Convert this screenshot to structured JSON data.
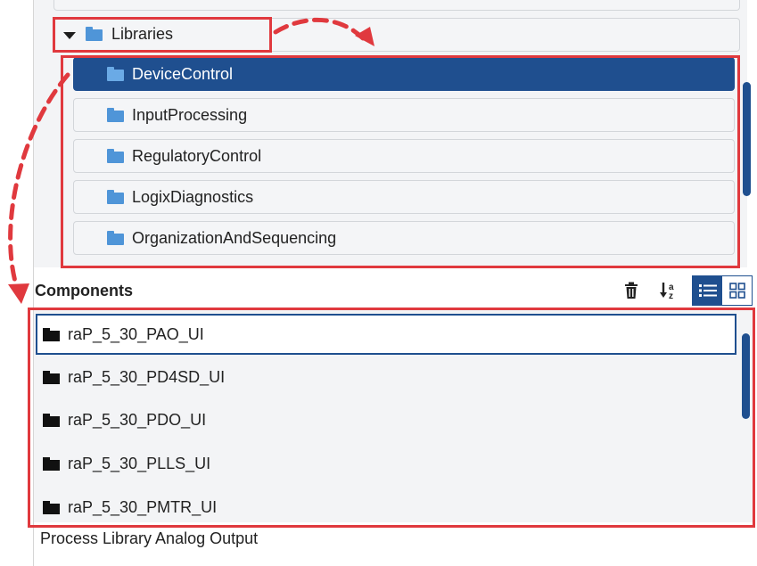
{
  "tree": {
    "libraries_label": "Libraries",
    "items": [
      {
        "label": "DeviceControl",
        "selected": true
      },
      {
        "label": "InputProcessing",
        "selected": false
      },
      {
        "label": "RegulatoryControl",
        "selected": false
      },
      {
        "label": "LogixDiagnostics",
        "selected": false
      },
      {
        "label": "OrganizationAndSequencing",
        "selected": false
      }
    ]
  },
  "components": {
    "title": "Components",
    "tools": {
      "delete_icon": "trash-icon",
      "sort_icon": "sort-az-icon",
      "list_view_icon": "list-view-icon",
      "grid_view_icon": "grid-view-icon"
    },
    "items": [
      {
        "label": "raP_5_30_PAO_UI",
        "selected": true
      },
      {
        "label": "raP_5_30_PD4SD_UI",
        "selected": false
      },
      {
        "label": "raP_5_30_PDO_UI",
        "selected": false
      },
      {
        "label": "raP_5_30_PLLS_UI",
        "selected": false
      },
      {
        "label": "raP_5_30_PMTR_UI",
        "selected": false
      }
    ],
    "description": "Process Library Analog Output"
  },
  "colors": {
    "accent": "#1f4f8f",
    "annotation_red": "#e0393e",
    "folder_blue": "#4f95d8"
  }
}
